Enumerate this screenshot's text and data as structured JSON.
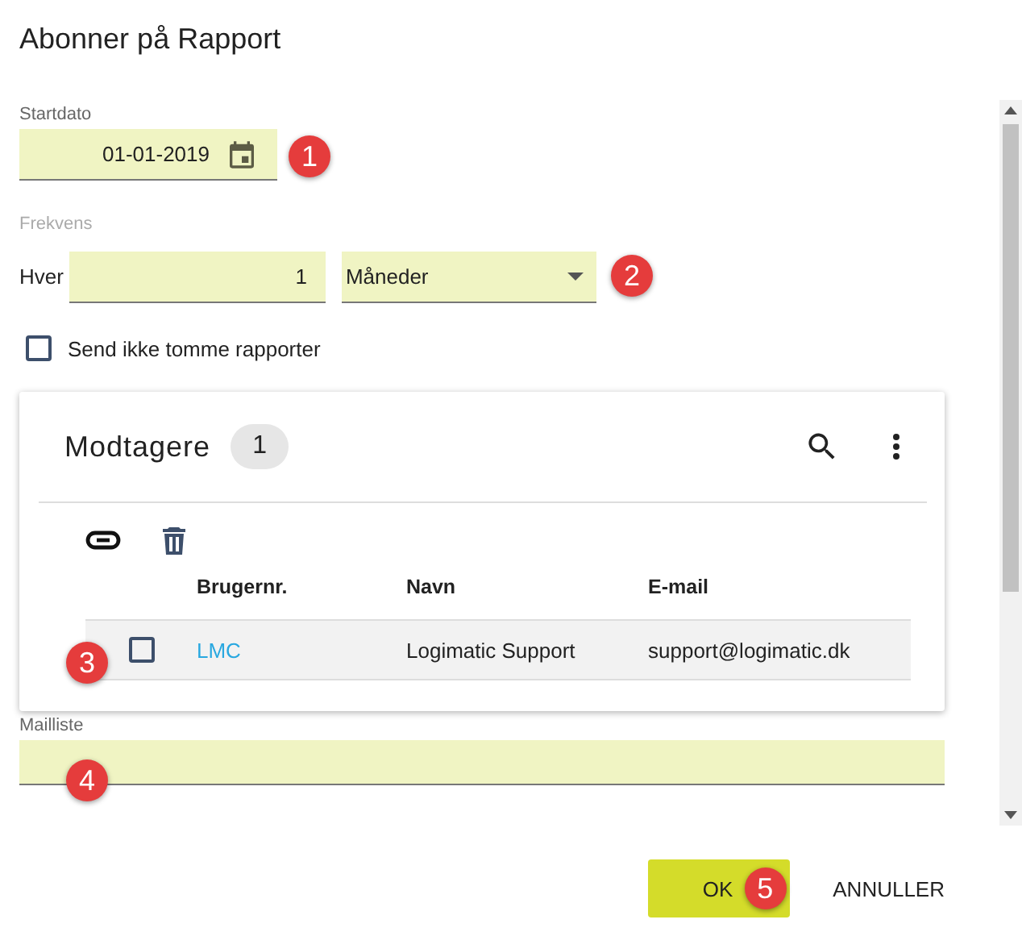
{
  "dialog": {
    "title": "Abonner på Rapport"
  },
  "start_date": {
    "label": "Startdato",
    "value": "01-01-2019"
  },
  "frequency": {
    "label": "Frekvens",
    "prefix": "Hver",
    "count": "1",
    "unit": "Måneder"
  },
  "skip_empty": {
    "label": "Send ikke tomme rapporter",
    "checked": false
  },
  "recipients": {
    "title": "Modtagere",
    "count": "1",
    "columns": [
      "Brugernr.",
      "Navn",
      "E-mail"
    ],
    "rows": [
      {
        "user": "LMC",
        "name": "Logimatic Support",
        "email": "support@logimatic.dk",
        "checked": false,
        "highlighted": true
      }
    ]
  },
  "mailing_list": {
    "label": "Mailliste"
  },
  "buttons": [
    {
      "label": "OK",
      "kind": "primary",
      "marker": "5"
    },
    {
      "label": "ANNULLER",
      "kind": "flat"
    }
  ],
  "markers": [
    "1",
    "2",
    "3",
    "4"
  ]
}
